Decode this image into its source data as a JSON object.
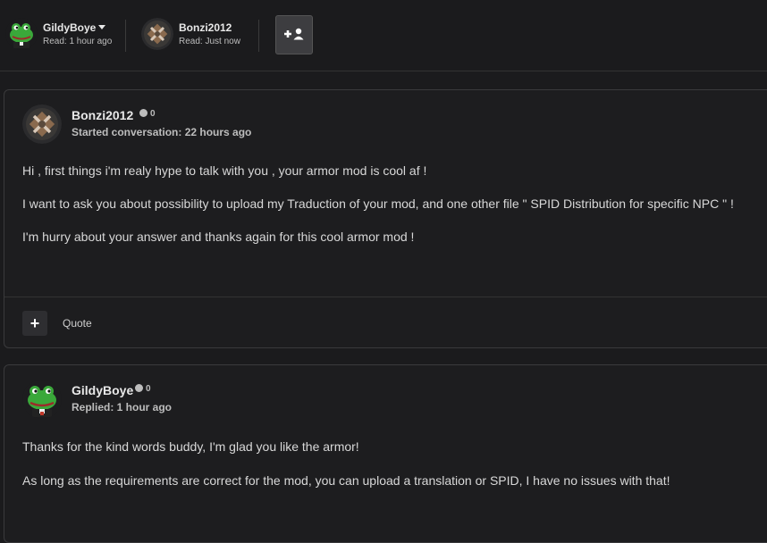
{
  "header": {
    "participants": [
      {
        "name": "GildyBoye",
        "read": "Read: 1 hour ago",
        "avatar_icon": "frog-avatar-icon",
        "has_dropdown": true
      },
      {
        "name": "Bonzi2012",
        "read": "Read: Just now",
        "avatar_icon": "mod-logo-avatar-icon",
        "has_dropdown": false
      }
    ],
    "add_user_icon": "plus-user-icon"
  },
  "messages": [
    {
      "author": "Bonzi2012",
      "status_count": "0",
      "subtitle": "Started conversation: 22 hours ago",
      "paragraphs": [
        "Hi , first things i'm realy hype to talk with you , your armor mod is cool af !",
        "I want to ask you about possibility to upload my Traduction of your mod, and one other file \" SPID Distribution for specific NPC \" !",
        "I'm hurry about your answer and thanks again for this cool armor mod !"
      ],
      "actions": {
        "plus_label": "+",
        "quote_label": "Quote"
      }
    },
    {
      "author": "GildyBoye",
      "status_count": "0",
      "subtitle": "Replied: 1 hour ago",
      "paragraphs": [
        "Thanks for the kind words buddy, I'm glad you like the armor!",
        "As long as the requirements are correct for the mod, you can upload a translation or SPID, I have no issues with that!"
      ]
    }
  ],
  "colors": {
    "background": "#1b1b1d",
    "card_border": "#3a3a3c",
    "text": "#d8d8d8",
    "muted": "#bdbdbd"
  }
}
